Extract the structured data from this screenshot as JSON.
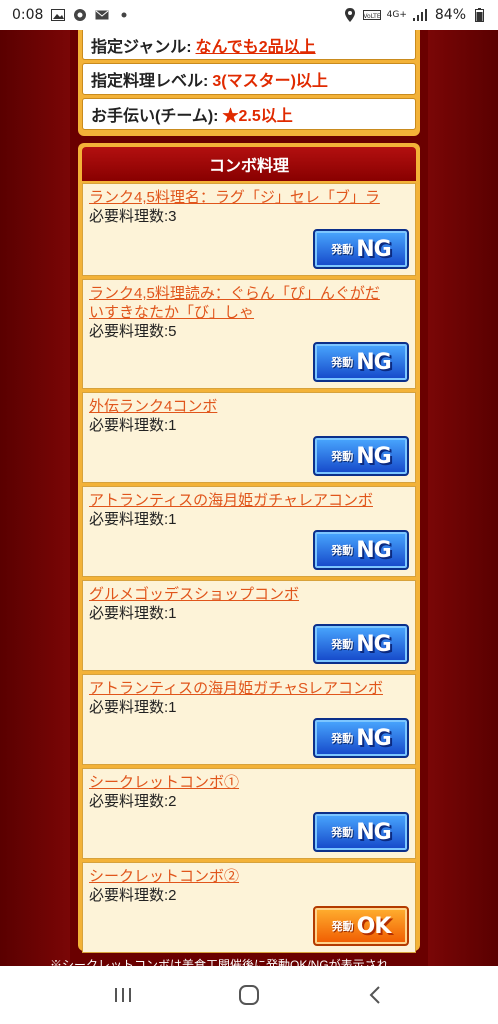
{
  "status_bar": {
    "time": "0:08",
    "network": "4G+",
    "battery": "84%"
  },
  "conditions": [
    {
      "label": "指定ジャンル:",
      "value": "なんでも2品以上",
      "link": true
    },
    {
      "label": "指定料理レベル:",
      "value": "3(マスター)以上",
      "link": false
    },
    {
      "label": "お手伝い(チーム):",
      "value": "★2.5以上",
      "link": false
    }
  ],
  "combo": {
    "header": "コンボ料理",
    "items": [
      {
        "name_lines": [
          "ランク4,5料理名：ラグ「ジ」セレ「ブ」ラ"
        ],
        "req": "必要料理数:3",
        "badge_pre": "発動",
        "badge_main": "NG",
        "status": "ng"
      },
      {
        "name_lines": [
          "ランク4,5料理読み：ぐらん「ぴ」んぐがだ",
          "いすきなたか「び」しゃ"
        ],
        "req": "必要料理数:5",
        "badge_pre": "発動",
        "badge_main": "NG",
        "status": "ng"
      },
      {
        "name_lines": [
          "外伝ランク4コンボ"
        ],
        "req": "必要料理数:1",
        "badge_pre": "発動",
        "badge_main": "NG",
        "status": "ng"
      },
      {
        "name_lines": [
          "アトランティスの海月姫ガチャレアコンボ"
        ],
        "req": "必要料理数:1",
        "badge_pre": "発動",
        "badge_main": "NG",
        "status": "ng"
      },
      {
        "name_lines": [
          "グルメゴッデスショップコンボ"
        ],
        "req": "必要料理数:1",
        "badge_pre": "発動",
        "badge_main": "NG",
        "status": "ng"
      },
      {
        "name_lines": [
          "アトランティスの海月姫ガチャSレアコンボ"
        ],
        "req": "必要料理数:1",
        "badge_pre": "発動",
        "badge_main": "NG",
        "status": "ng"
      },
      {
        "name_lines": [
          "シークレットコンボ①"
        ],
        "req": "必要料理数:2",
        "badge_pre": "発動",
        "badge_main": "NG",
        "status": "ng"
      },
      {
        "name_lines": [
          "シークレットコンボ②"
        ],
        "req": "必要料理数:2",
        "badge_pre": "発動",
        "badge_main": "OK",
        "status": "ok"
      }
    ]
  },
  "footnote": "※シークレットコンボは美食工開催後に発動OK/NGが表示され",
  "icons": {
    "status_left": [
      "image-icon",
      "chrome-icon",
      "mail-icon",
      "dot-icon"
    ],
    "status_right": [
      "location-icon",
      "volte-icon",
      "signal-icon",
      "battery-icon"
    ],
    "nav": [
      "recent-apps-icon",
      "home-icon",
      "back-icon"
    ]
  }
}
